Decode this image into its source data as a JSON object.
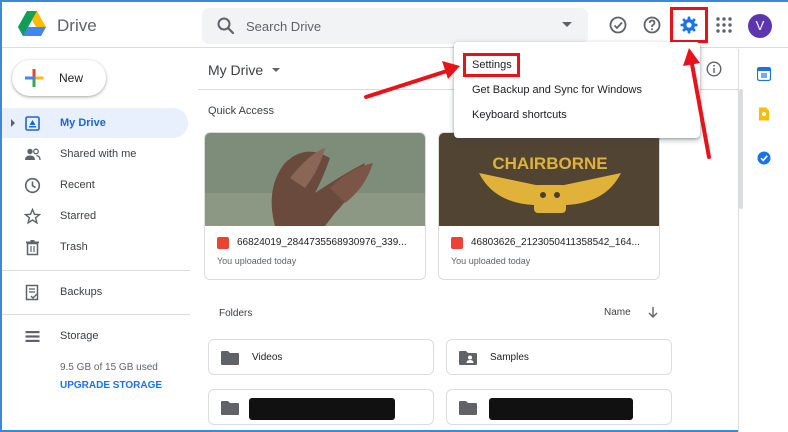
{
  "header": {
    "app_name": "Drive",
    "search_placeholder": "Search Drive",
    "avatar_initial": "V"
  },
  "sidebar": {
    "new_label": "New",
    "items": [
      {
        "label": "My Drive",
        "icon": "my-drive-icon",
        "active": true
      },
      {
        "label": "Shared with me",
        "icon": "shared-icon"
      },
      {
        "label": "Recent",
        "icon": "clock-icon"
      },
      {
        "label": "Starred",
        "icon": "star-icon"
      },
      {
        "label": "Trash",
        "icon": "trash-icon"
      },
      {
        "label": "Backups",
        "icon": "backup-icon"
      },
      {
        "label": "Storage",
        "icon": "storage-icon"
      }
    ],
    "storage_used": "9.5 GB of 15 GB used",
    "upgrade_label": "UPGRADE STORAGE"
  },
  "main": {
    "breadcrumb": "My Drive",
    "quick_access_title": "Quick Access",
    "cards": [
      {
        "name": "66824019_2844735568930976_339...",
        "subtitle": "You uploaded today"
      },
      {
        "name": "46803626_2123050411358542_164...",
        "subtitle": "You uploaded today",
        "thumb_text": "CHAIRBORNE"
      }
    ],
    "folders_title": "Folders",
    "sort_label": "Name",
    "folders": [
      {
        "name": "Videos",
        "icon": "folder-icon"
      },
      {
        "name": "Samples",
        "icon": "shared-folder-icon"
      },
      {
        "name": "",
        "icon": "folder-icon",
        "redacted": true
      },
      {
        "name": "",
        "icon": "folder-icon",
        "redacted": true
      }
    ]
  },
  "settings_menu": {
    "items": [
      "Settings",
      "Get Backup and Sync for Windows",
      "Keyboard shortcuts"
    ]
  },
  "colors": {
    "accent": "#1a73e8",
    "active_bg": "#e8f0fe",
    "annotation_red": "#e8121b",
    "avatar": "#5e35b1"
  }
}
